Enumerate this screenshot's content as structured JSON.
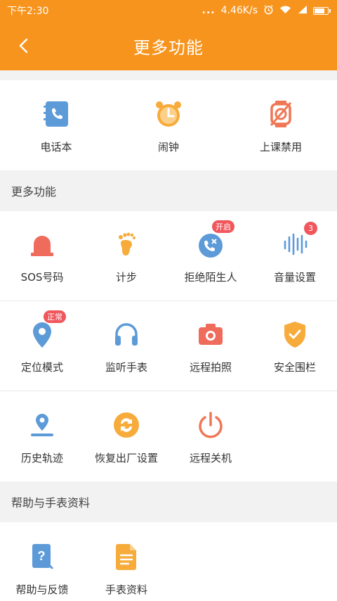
{
  "status_bar": {
    "time": "下午2:30",
    "dots": "...",
    "network_speed": "4.46K/s"
  },
  "header": {
    "title": "更多功能"
  },
  "top_features": [
    {
      "label": "电话本",
      "icon": "phonebook-icon",
      "color": "#5d9ad8"
    },
    {
      "label": "闹钟",
      "icon": "alarm-clock-icon",
      "color": "#f7ab3a"
    },
    {
      "label": "上课禁用",
      "icon": "class-ban-icon",
      "color": "#ef7755"
    }
  ],
  "sections": {
    "more": "更多功能",
    "help": "帮助与手表资料"
  },
  "more_features": {
    "row1": [
      {
        "label": "SOS号码",
        "icon": "sos-alarm-icon",
        "color": "#ef6b5b"
      },
      {
        "label": "计步",
        "icon": "footprint-icon",
        "color": "#f7ab3a"
      },
      {
        "label": "拒绝陌生人",
        "icon": "reject-call-icon",
        "color": "#5d9ad8",
        "badge": "开启"
      },
      {
        "label": "音量设置",
        "icon": "volume-icon",
        "color": "#5d9ad8",
        "badge": "3"
      }
    ],
    "row2": [
      {
        "label": "定位模式",
        "icon": "location-pin-icon",
        "color": "#5d9ad8",
        "badge": "正常"
      },
      {
        "label": "监听手表",
        "icon": "headphone-icon",
        "color": "#5d9ad8"
      },
      {
        "label": "远程拍照",
        "icon": "camera-icon",
        "color": "#ef6b5b"
      },
      {
        "label": "安全围栏",
        "icon": "shield-check-icon",
        "color": "#f7ab3a"
      }
    ],
    "row3": [
      {
        "label": "历史轨迹",
        "icon": "track-pin-icon",
        "color": "#5d9ad8"
      },
      {
        "label": "恢复出厂设置",
        "icon": "factory-reset-icon",
        "color": "#f7ab3a"
      },
      {
        "label": "远程关机",
        "icon": "power-icon",
        "color": "#ef7755"
      }
    ]
  },
  "help_features": [
    {
      "label": "帮助与反馈",
      "icon": "help-doc-icon",
      "color": "#5d9ad8"
    },
    {
      "label": "手表资料",
      "icon": "watch-doc-icon",
      "color": "#f7ab3a"
    }
  ],
  "colors": {
    "brand": "#f7941d",
    "badge": "#f0565c",
    "blue": "#5d9ad8",
    "orange": "#f7ab3a",
    "red": "#ef6b5b"
  }
}
